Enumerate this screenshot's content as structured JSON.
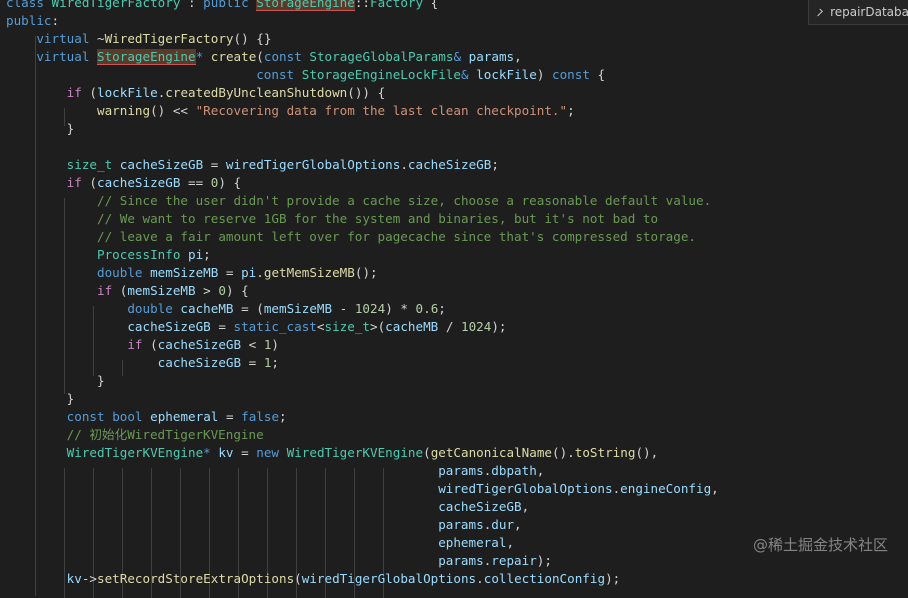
{
  "breadcrumb": {
    "symbol": "repairDataba"
  },
  "watermark": "@稀土掘金技术社区",
  "code": [
    {
      "tokens": [
        [
          "kw",
          "class"
        ],
        [
          "pl",
          " "
        ],
        [
          "ty",
          "WiredTigerFactory"
        ],
        [
          "pl",
          " : "
        ],
        [
          "kw",
          "public"
        ],
        [
          "pl",
          " "
        ],
        [
          "hl",
          "StorageEngine"
        ],
        [
          "pl",
          "::"
        ],
        [
          "ty",
          "Factory"
        ],
        [
          "pl",
          " {"
        ]
      ]
    },
    {
      "tokens": [
        [
          "kw",
          "public"
        ],
        [
          "pl",
          ":"
        ]
      ]
    },
    {
      "tokens": [
        [
          "pl",
          "    "
        ],
        [
          "kw",
          "virtual"
        ],
        [
          "pl",
          " ~"
        ],
        [
          "fn",
          "WiredTigerFactory"
        ],
        [
          "pl",
          "() {}"
        ]
      ]
    },
    {
      "tokens": [
        [
          "pl",
          "    "
        ],
        [
          "kw",
          "virtual"
        ],
        [
          "pl",
          " "
        ],
        [
          "hl",
          "StorageEngine"
        ],
        [
          "kw",
          "*"
        ],
        [
          "pl",
          " "
        ],
        [
          "fn",
          "create"
        ],
        [
          "pl",
          "("
        ],
        [
          "kw",
          "const"
        ],
        [
          "pl",
          " "
        ],
        [
          "ty",
          "StorageGlobalParams"
        ],
        [
          "kw",
          "&"
        ],
        [
          "pl",
          " "
        ],
        [
          "var",
          "params"
        ],
        [
          "pl",
          ","
        ]
      ]
    },
    {
      "tokens": [
        [
          "pl",
          "                                 "
        ],
        [
          "kw",
          "const"
        ],
        [
          "pl",
          " "
        ],
        [
          "ty",
          "StorageEngineLockFile"
        ],
        [
          "kw",
          "&"
        ],
        [
          "pl",
          " "
        ],
        [
          "var",
          "lockFile"
        ],
        [
          "pl",
          ") "
        ],
        [
          "kw",
          "const"
        ],
        [
          "pl",
          " {"
        ]
      ]
    },
    {
      "tokens": [
        [
          "pl",
          "        "
        ],
        [
          "ctl",
          "if"
        ],
        [
          "pl",
          " ("
        ],
        [
          "var",
          "lockFile"
        ],
        [
          "pl",
          "."
        ],
        [
          "fn",
          "createdByUncleanShutdown"
        ],
        [
          "pl",
          "()) {"
        ]
      ]
    },
    {
      "tokens": [
        [
          "pl",
          "            "
        ],
        [
          "fn",
          "warning"
        ],
        [
          "pl",
          "() << "
        ],
        [
          "str",
          "\"Recovering data from the last clean checkpoint.\""
        ],
        [
          "pl",
          ";"
        ]
      ]
    },
    {
      "tokens": [
        [
          "pl",
          "        }"
        ]
      ]
    },
    {
      "tokens": [
        [
          "pl",
          ""
        ]
      ]
    },
    {
      "tokens": [
        [
          "pl",
          "        "
        ],
        [
          "ty",
          "size_t"
        ],
        [
          "pl",
          " "
        ],
        [
          "var",
          "cacheSizeGB"
        ],
        [
          "pl",
          " = "
        ],
        [
          "var",
          "wiredTigerGlobalOptions"
        ],
        [
          "pl",
          "."
        ],
        [
          "var",
          "cacheSizeGB"
        ],
        [
          "pl",
          ";"
        ]
      ]
    },
    {
      "tokens": [
        [
          "pl",
          "        "
        ],
        [
          "ctl",
          "if"
        ],
        [
          "pl",
          " ("
        ],
        [
          "var",
          "cacheSizeGB"
        ],
        [
          "pl",
          " == "
        ],
        [
          "num",
          "0"
        ],
        [
          "pl",
          ") {"
        ]
      ]
    },
    {
      "tokens": [
        [
          "pl",
          "            "
        ],
        [
          "cm",
          "// Since the user didn't provide a cache size, choose a reasonable default value."
        ]
      ]
    },
    {
      "tokens": [
        [
          "pl",
          "            "
        ],
        [
          "cm",
          "// We want to reserve 1GB for the system and binaries, but it's not bad to"
        ]
      ]
    },
    {
      "tokens": [
        [
          "pl",
          "            "
        ],
        [
          "cm",
          "// leave a fair amount left over for pagecache since that's compressed storage."
        ]
      ]
    },
    {
      "tokens": [
        [
          "pl",
          "            "
        ],
        [
          "ty",
          "ProcessInfo"
        ],
        [
          "pl",
          " "
        ],
        [
          "var",
          "pi"
        ],
        [
          "pl",
          ";"
        ]
      ]
    },
    {
      "tokens": [
        [
          "pl",
          "            "
        ],
        [
          "kw",
          "double"
        ],
        [
          "pl",
          " "
        ],
        [
          "var",
          "memSizeMB"
        ],
        [
          "pl",
          " = "
        ],
        [
          "var",
          "pi"
        ],
        [
          "pl",
          "."
        ],
        [
          "fn",
          "getMemSizeMB"
        ],
        [
          "pl",
          "();"
        ]
      ]
    },
    {
      "tokens": [
        [
          "pl",
          "            "
        ],
        [
          "ctl",
          "if"
        ],
        [
          "pl",
          " ("
        ],
        [
          "var",
          "memSizeMB"
        ],
        [
          "pl",
          " > "
        ],
        [
          "num",
          "0"
        ],
        [
          "pl",
          ") {"
        ]
      ]
    },
    {
      "tokens": [
        [
          "pl",
          "                "
        ],
        [
          "kw",
          "double"
        ],
        [
          "pl",
          " "
        ],
        [
          "var",
          "cacheMB"
        ],
        [
          "pl",
          " = ("
        ],
        [
          "var",
          "memSizeMB"
        ],
        [
          "pl",
          " - "
        ],
        [
          "num",
          "1024"
        ],
        [
          "pl",
          ") * "
        ],
        [
          "num",
          "0.6"
        ],
        [
          "pl",
          ";"
        ]
      ]
    },
    {
      "tokens": [
        [
          "pl",
          "                "
        ],
        [
          "var",
          "cacheSizeGB"
        ],
        [
          "pl",
          " = "
        ],
        [
          "kw",
          "static_cast"
        ],
        [
          "pl",
          "<"
        ],
        [
          "ty",
          "size_t"
        ],
        [
          "pl",
          ">("
        ],
        [
          "var",
          "cacheMB"
        ],
        [
          "pl",
          " / "
        ],
        [
          "num",
          "1024"
        ],
        [
          "pl",
          ");"
        ]
      ]
    },
    {
      "tokens": [
        [
          "pl",
          "                "
        ],
        [
          "ctl",
          "if"
        ],
        [
          "pl",
          " ("
        ],
        [
          "var",
          "cacheSizeGB"
        ],
        [
          "pl",
          " < "
        ],
        [
          "num",
          "1"
        ],
        [
          "pl",
          ")"
        ]
      ]
    },
    {
      "tokens": [
        [
          "pl",
          "                    "
        ],
        [
          "var",
          "cacheSizeGB"
        ],
        [
          "pl",
          " = "
        ],
        [
          "num",
          "1"
        ],
        [
          "pl",
          ";"
        ]
      ]
    },
    {
      "tokens": [
        [
          "pl",
          "            }"
        ]
      ]
    },
    {
      "tokens": [
        [
          "pl",
          "        }"
        ]
      ]
    },
    {
      "tokens": [
        [
          "pl",
          "        "
        ],
        [
          "kw",
          "const"
        ],
        [
          "pl",
          " "
        ],
        [
          "kw",
          "bool"
        ],
        [
          "pl",
          " "
        ],
        [
          "var",
          "ephemeral"
        ],
        [
          "pl",
          " = "
        ],
        [
          "kw",
          "false"
        ],
        [
          "pl",
          ";"
        ]
      ]
    },
    {
      "tokens": [
        [
          "pl",
          "        "
        ],
        [
          "cm",
          "// 初始化WiredTigerKVEngine"
        ]
      ]
    },
    {
      "tokens": [
        [
          "pl",
          "        "
        ],
        [
          "ty",
          "WiredTigerKVEngine"
        ],
        [
          "kw",
          "*"
        ],
        [
          "pl",
          " "
        ],
        [
          "var",
          "kv"
        ],
        [
          "pl",
          " = "
        ],
        [
          "kw",
          "new"
        ],
        [
          "pl",
          " "
        ],
        [
          "ty",
          "WiredTigerKVEngine"
        ],
        [
          "pl",
          "("
        ],
        [
          "fn",
          "getCanonicalName"
        ],
        [
          "pl",
          "()."
        ],
        [
          "fn",
          "toString"
        ],
        [
          "pl",
          "(),"
        ]
      ]
    },
    {
      "tokens": [
        [
          "pl",
          "                                                         "
        ],
        [
          "var",
          "params"
        ],
        [
          "pl",
          "."
        ],
        [
          "var",
          "dbpath"
        ],
        [
          "pl",
          ","
        ]
      ]
    },
    {
      "tokens": [
        [
          "pl",
          "                                                         "
        ],
        [
          "var",
          "wiredTigerGlobalOptions"
        ],
        [
          "pl",
          "."
        ],
        [
          "var",
          "engineConfig"
        ],
        [
          "pl",
          ","
        ]
      ]
    },
    {
      "tokens": [
        [
          "pl",
          "                                                         "
        ],
        [
          "var",
          "cacheSizeGB"
        ],
        [
          "pl",
          ","
        ]
      ]
    },
    {
      "tokens": [
        [
          "pl",
          "                                                         "
        ],
        [
          "var",
          "params"
        ],
        [
          "pl",
          "."
        ],
        [
          "var",
          "dur"
        ],
        [
          "pl",
          ","
        ]
      ]
    },
    {
      "tokens": [
        [
          "pl",
          "                                                         "
        ],
        [
          "var",
          "ephemeral"
        ],
        [
          "pl",
          ","
        ]
      ]
    },
    {
      "tokens": [
        [
          "pl",
          "                                                         "
        ],
        [
          "var",
          "params"
        ],
        [
          "pl",
          "."
        ],
        [
          "var",
          "repair"
        ],
        [
          "pl",
          ");"
        ]
      ]
    },
    {
      "tokens": [
        [
          "pl",
          "        "
        ],
        [
          "var",
          "kv"
        ],
        [
          "pl",
          "->"
        ],
        [
          "fn",
          "setRecordStoreExtraOptions"
        ],
        [
          "pl",
          "("
        ],
        [
          "var",
          "wiredTigerGlobalOptions"
        ],
        [
          "pl",
          "."
        ],
        [
          "var",
          "collectionConfig"
        ],
        [
          "pl",
          ");"
        ]
      ]
    }
  ]
}
